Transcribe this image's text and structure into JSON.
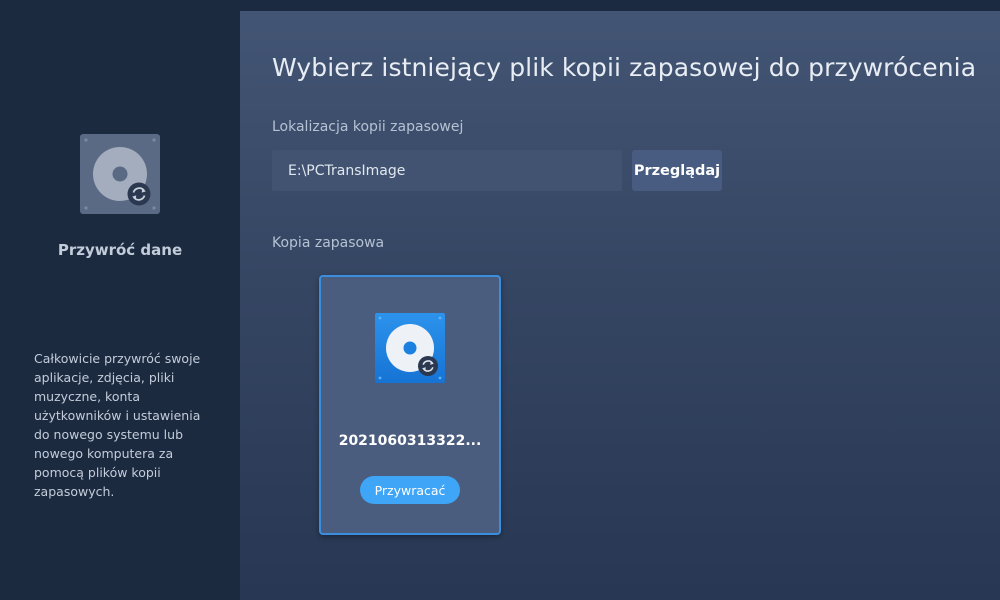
{
  "sidebar": {
    "icon": "restore-disk-icon",
    "title": "Przywróć dane",
    "description": "Całkowicie przywróć swoje aplikacje, zdjęcia, pliki muzyczne, konta użytkowników i ustawienia do nowego systemu lub nowego komputera za pomocą plików kopii zapasowych."
  },
  "main": {
    "title": "Wybierz istniejący plik kopii zapasowej do przywrócenia",
    "location_label": "Lokalizacja kopii zapasowej",
    "location_value": "E:\\PCTransImage",
    "browse_label": "Przeglądaj",
    "backup_label": "Kopia zapasowa",
    "backups": [
      {
        "name": "2021060313322...",
        "icon": "backup-disk-icon",
        "restore_label": "Przywracać"
      }
    ]
  },
  "colors": {
    "accent": "#3ea5f7",
    "sidebar_bg": "#1c2a40",
    "card_border": "#3b8dde"
  }
}
